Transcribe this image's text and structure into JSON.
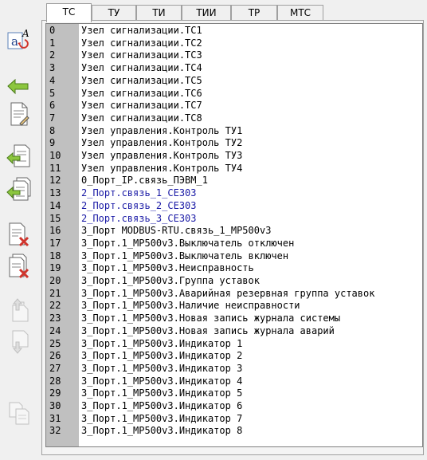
{
  "tabs": [
    {
      "label": "ТС",
      "active": true
    },
    {
      "label": "ТУ",
      "active": false
    },
    {
      "label": "ТИ",
      "active": false
    },
    {
      "label": "ТИИ",
      "active": false
    },
    {
      "label": "ТР",
      "active": false
    },
    {
      "label": "МТС",
      "active": false
    }
  ],
  "toolbar": [
    {
      "icon": "rename-text-icon",
      "enabled": true
    },
    {
      "icon": "arrow-left-icon",
      "enabled": true
    },
    {
      "icon": "edit-document-icon",
      "enabled": true
    },
    {
      "icon": "document-import-icon",
      "enabled": true
    },
    {
      "icon": "document-import-multiple-icon",
      "enabled": true
    },
    {
      "icon": "document-delete-icon",
      "enabled": true
    },
    {
      "icon": "document-delete-multiple-icon",
      "enabled": true
    },
    {
      "icon": "move-up-icon",
      "enabled": false
    },
    {
      "icon": "move-down-icon",
      "enabled": false
    },
    {
      "icon": "copy-document-icon",
      "enabled": false
    }
  ],
  "colors": {
    "link_blue": "#1a1aa6",
    "index_bg": "#c0c0c0"
  },
  "rows": [
    {
      "index": "0",
      "text": "Узел сигнализации.ТС1",
      "blue": false
    },
    {
      "index": "1",
      "text": "Узел сигнализации.ТС2",
      "blue": false
    },
    {
      "index": "2",
      "text": "Узел сигнализации.ТС3",
      "blue": false
    },
    {
      "index": "3",
      "text": "Узел сигнализации.ТС4",
      "blue": false
    },
    {
      "index": "4",
      "text": "Узел сигнализации.ТС5",
      "blue": false
    },
    {
      "index": "5",
      "text": "Узел сигнализации.ТС6",
      "blue": false
    },
    {
      "index": "6",
      "text": "Узел сигнализации.ТС7",
      "blue": false
    },
    {
      "index": "7",
      "text": "Узел сигнализации.ТС8",
      "blue": false
    },
    {
      "index": "8",
      "text": "Узел управления.Контроль ТУ1",
      "blue": false
    },
    {
      "index": "9",
      "text": "Узел управления.Контроль ТУ2",
      "blue": false
    },
    {
      "index": "10",
      "text": "Узел управления.Контроль ТУ3",
      "blue": false
    },
    {
      "index": "11",
      "text": "Узел управления.Контроль ТУ4",
      "blue": false
    },
    {
      "index": "12",
      "text": "0_Порт_IP.связь_ПЭВМ_1",
      "blue": false
    },
    {
      "index": "13",
      "text": "2_Порт.связь_1_CE303",
      "blue": true
    },
    {
      "index": "14",
      "text": "2_Порт.связь_2_CE303",
      "blue": true
    },
    {
      "index": "15",
      "text": "2_Порт.связь_3_CE303",
      "blue": true
    },
    {
      "index": "16",
      "text": "3_Порт MODBUS-RTU.связь_1_MP500v3",
      "blue": false
    },
    {
      "index": "17",
      "text": "3_Порт.1_MP500v3.Выключатель отключен",
      "blue": false
    },
    {
      "index": "18",
      "text": "3_Порт.1_MP500v3.Выключатель включен",
      "blue": false
    },
    {
      "index": "19",
      "text": "3_Порт.1_MP500v3.Неисправность",
      "blue": false
    },
    {
      "index": "20",
      "text": "3_Порт.1_MP500v3.Группа уставок",
      "blue": false
    },
    {
      "index": "21",
      "text": "3_Порт.1_MP500v3.Аварийная резервная группа уставок",
      "blue": false
    },
    {
      "index": "22",
      "text": "3_Порт.1_MP500v3.Наличие неисправности",
      "blue": false
    },
    {
      "index": "23",
      "text": "3_Порт.1_MP500v3.Новая запись журнала системы",
      "blue": false
    },
    {
      "index": "24",
      "text": "3_Порт.1_MP500v3.Новая запись журнала аварий",
      "blue": false
    },
    {
      "index": "25",
      "text": "3_Порт.1_MP500v3.Индикатор 1",
      "blue": false
    },
    {
      "index": "26",
      "text": "3_Порт.1_MP500v3.Индикатор 2",
      "blue": false
    },
    {
      "index": "27",
      "text": "3_Порт.1_MP500v3.Индикатор 3",
      "blue": false
    },
    {
      "index": "28",
      "text": "3_Порт.1_MP500v3.Индикатор 4",
      "blue": false
    },
    {
      "index": "29",
      "text": "3_Порт.1_MP500v3.Индикатор 5",
      "blue": false
    },
    {
      "index": "30",
      "text": "3_Порт.1_MP500v3.Индикатор 6",
      "blue": false
    },
    {
      "index": "31",
      "text": "3_Порт.1_MP500v3.Индикатор 7",
      "blue": false
    },
    {
      "index": "32",
      "text": "3_Порт.1_MP500v3.Индикатор 8",
      "blue": false
    }
  ]
}
